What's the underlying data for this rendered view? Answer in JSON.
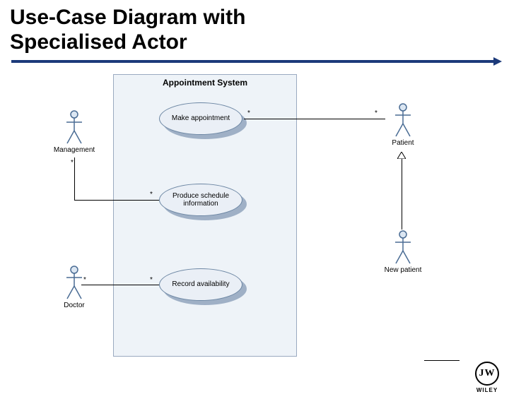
{
  "title_line1": "Use-Case Diagram with",
  "title_line2": "Specialised Actor",
  "system_name": "Appointment System",
  "usecases": {
    "uc1": "Make appointment",
    "uc2": "Produce schedule information",
    "uc3": "Record availability"
  },
  "actors": {
    "management": "Management",
    "doctor": "Doctor",
    "patient": "Patient",
    "new_patient": "New patient"
  },
  "multiplicity": "*",
  "publisher": {
    "mark": "JW",
    "name": "WILEY"
  }
}
